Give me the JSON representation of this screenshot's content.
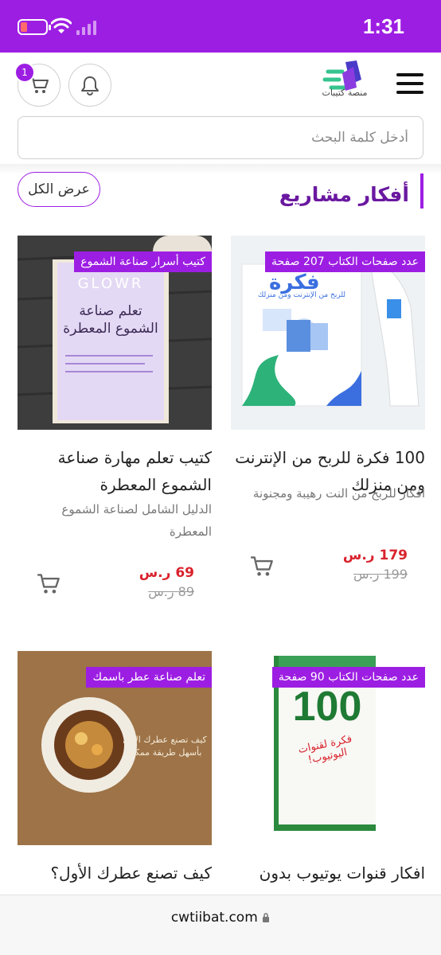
{
  "status_bar": {
    "time": "1:31"
  },
  "header": {
    "cart_count": "1",
    "logo_text": "منصة كتيبات",
    "icons": [
      "cart-icon",
      "bell-icon",
      "hamburger-menu-icon"
    ]
  },
  "search": {
    "placeholder": "أدخل كلمة البحث"
  },
  "section": {
    "title": "أفكار مشاريع",
    "view_all_label": "عرض الكل"
  },
  "products": [
    {
      "tag": "عدد صفحات الكتاب 207 صفحة",
      "cover_title": "فكرة",
      "cover_subtitle": "للربح من الإنترنت ومن منزلك",
      "title": "100 فكرة للربح من الإنترنت ومن منزلك",
      "description": "افكار للربح من النت رهيبة ومجنونة",
      "price": "179 ر.س",
      "old_price": "199 ر.س"
    },
    {
      "tag": "كتيب أسرار صناعة الشموع",
      "cover_brand": "GLOWR",
      "cover_title": "تعلم صناعة الشموع المعطرة",
      "title": "كتيب تعلم مهارة صناعة الشموع المعطرة",
      "description": "الدليل الشامل لصناعة الشموع المعطرة",
      "price": "69 ر.س",
      "old_price": "89 ر.س"
    },
    {
      "tag": "عدد صفحات الكتاب 90 صفحة",
      "cover_number": "100",
      "cover_title": "فكرة لقنوات اليوتيوب!",
      "title": "افكار قنوات يوتيوب بدون",
      "description": "",
      "price": "",
      "old_price": ""
    },
    {
      "tag": "تعلم صناعة عطر باسمك",
      "cover_title": "كيف تصنع عطرك الأول بأسهل طريقة ممكنة",
      "title": "كيف تصنع عطرك الأول؟",
      "description": "",
      "price": "",
      "old_price": ""
    }
  ],
  "url_bar": {
    "url": "cwtiibat.com"
  },
  "colors": {
    "primary": "#9d1ee3",
    "price_red": "#d9232d"
  }
}
